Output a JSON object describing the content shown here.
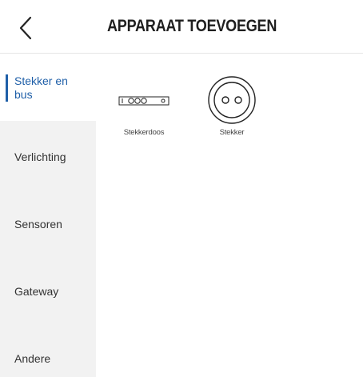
{
  "header": {
    "title": "APPARAAT TOEVOEGEN",
    "back_icon": "chevron-left-icon"
  },
  "sidebar": {
    "items": [
      {
        "label": "Stekker en bus",
        "active": true
      },
      {
        "label": "Verlichting",
        "active": false
      },
      {
        "label": "Sensoren",
        "active": false
      },
      {
        "label": "Gateway",
        "active": false
      },
      {
        "label": "Andere",
        "active": false
      }
    ]
  },
  "devices": [
    {
      "label": "Stekkerdoos",
      "icon": "power-strip-icon"
    },
    {
      "label": "Stekker",
      "icon": "wall-socket-icon"
    }
  ],
  "colors": {
    "accent": "#1f5fa8",
    "sidebar_bg": "#f2f2f2"
  }
}
